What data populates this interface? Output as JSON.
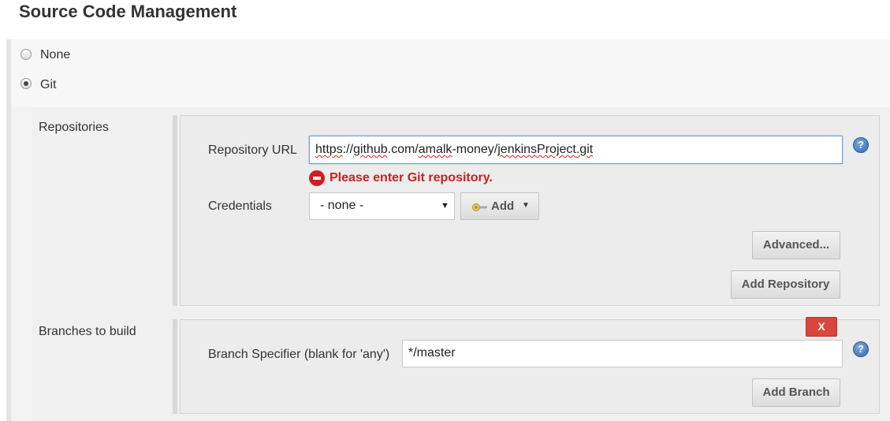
{
  "page": {
    "title": "Source Code Management"
  },
  "scm": {
    "options": [
      {
        "label": "None",
        "selected": false
      },
      {
        "label": "Git",
        "selected": true
      }
    ]
  },
  "repositories": {
    "section_label": "Repositories",
    "url_label": "Repository URL",
    "url_value": "https://github.com/amalk-money/jenkinsProject.git",
    "url_parts": [
      "https",
      "://",
      "github",
      ".com/",
      "amalk",
      "-money/",
      "jenkinsProject",
      ".git"
    ],
    "error_message": "Please enter Git repository.",
    "credentials_label": "Credentials",
    "credentials_selected": "- none -",
    "add_credentials_label": "Add",
    "advanced_label": "Advanced...",
    "add_repository_label": "Add Repository"
  },
  "branches": {
    "section_label": "Branches to build",
    "delete_label": "X",
    "specifier_label": "Branch Specifier (blank for 'any')",
    "specifier_value": "*/master",
    "add_branch_label": "Add Branch"
  },
  "help_icon_glyph": "?",
  "colors": {
    "error": "#cc1f1f",
    "delete_button": "#d9463b",
    "help_icon": "#2f6bb3"
  }
}
